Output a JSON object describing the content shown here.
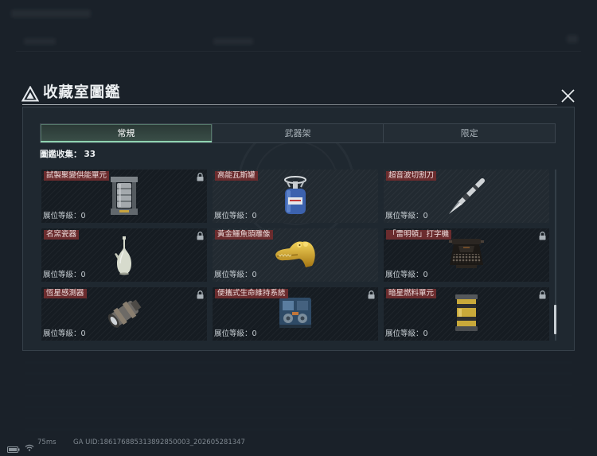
{
  "header": {
    "title": "收藏室圖鑑",
    "logo_icon": "triangle-logo-icon",
    "close_icon": "close-icon"
  },
  "tabs": [
    {
      "label": "常規",
      "active": true
    },
    {
      "label": "武器架",
      "active": false
    },
    {
      "label": "限定",
      "active": false
    }
  ],
  "collection": {
    "label": "圖鑑收集：",
    "count": "33"
  },
  "items": [
    {
      "name": "試製聚變供能單元",
      "level": "展位等級：0",
      "locked": true,
      "icon": "fusion-power-unit-icon"
    },
    {
      "name": "高能瓦斯罐",
      "level": "展位等級：0",
      "locked": false,
      "icon": "gas-canister-icon"
    },
    {
      "name": "超音波切割刀",
      "level": "展位等級：0",
      "locked": false,
      "icon": "ultrasonic-cutter-icon"
    },
    {
      "name": "名窯瓷器",
      "level": "展位等級：0",
      "locked": true,
      "icon": "porcelain-vase-icon"
    },
    {
      "name": "黃金鱷魚頭雕像",
      "level": "展位等級：0",
      "locked": false,
      "icon": "golden-crocodile-head-icon"
    },
    {
      "name": "「雷明頓」打字機",
      "level": "展位等級：0",
      "locked": true,
      "icon": "typewriter-icon"
    },
    {
      "name": "恆星感測器",
      "level": "展位等級：0",
      "locked": true,
      "icon": "stellar-sensor-icon"
    },
    {
      "name": "便攜式生命維持系統",
      "level": "展位等級：0",
      "locked": true,
      "icon": "life-support-system-icon"
    },
    {
      "name": "暗星燃料單元",
      "level": "展位等級：0",
      "locked": true,
      "icon": "dark-star-fuel-cell-icon"
    }
  ],
  "status_bar": {
    "battery_icon": "battery-icon",
    "wifi_icon": "wifi-icon",
    "ping": "75ms",
    "uid": "GA UID:186176885313892850003_202605281347"
  },
  "colors": {
    "accent": "#8fd3b0",
    "name_tag": "#6b2c2e",
    "panel": "#1f2830",
    "background": "#1a2129"
  }
}
